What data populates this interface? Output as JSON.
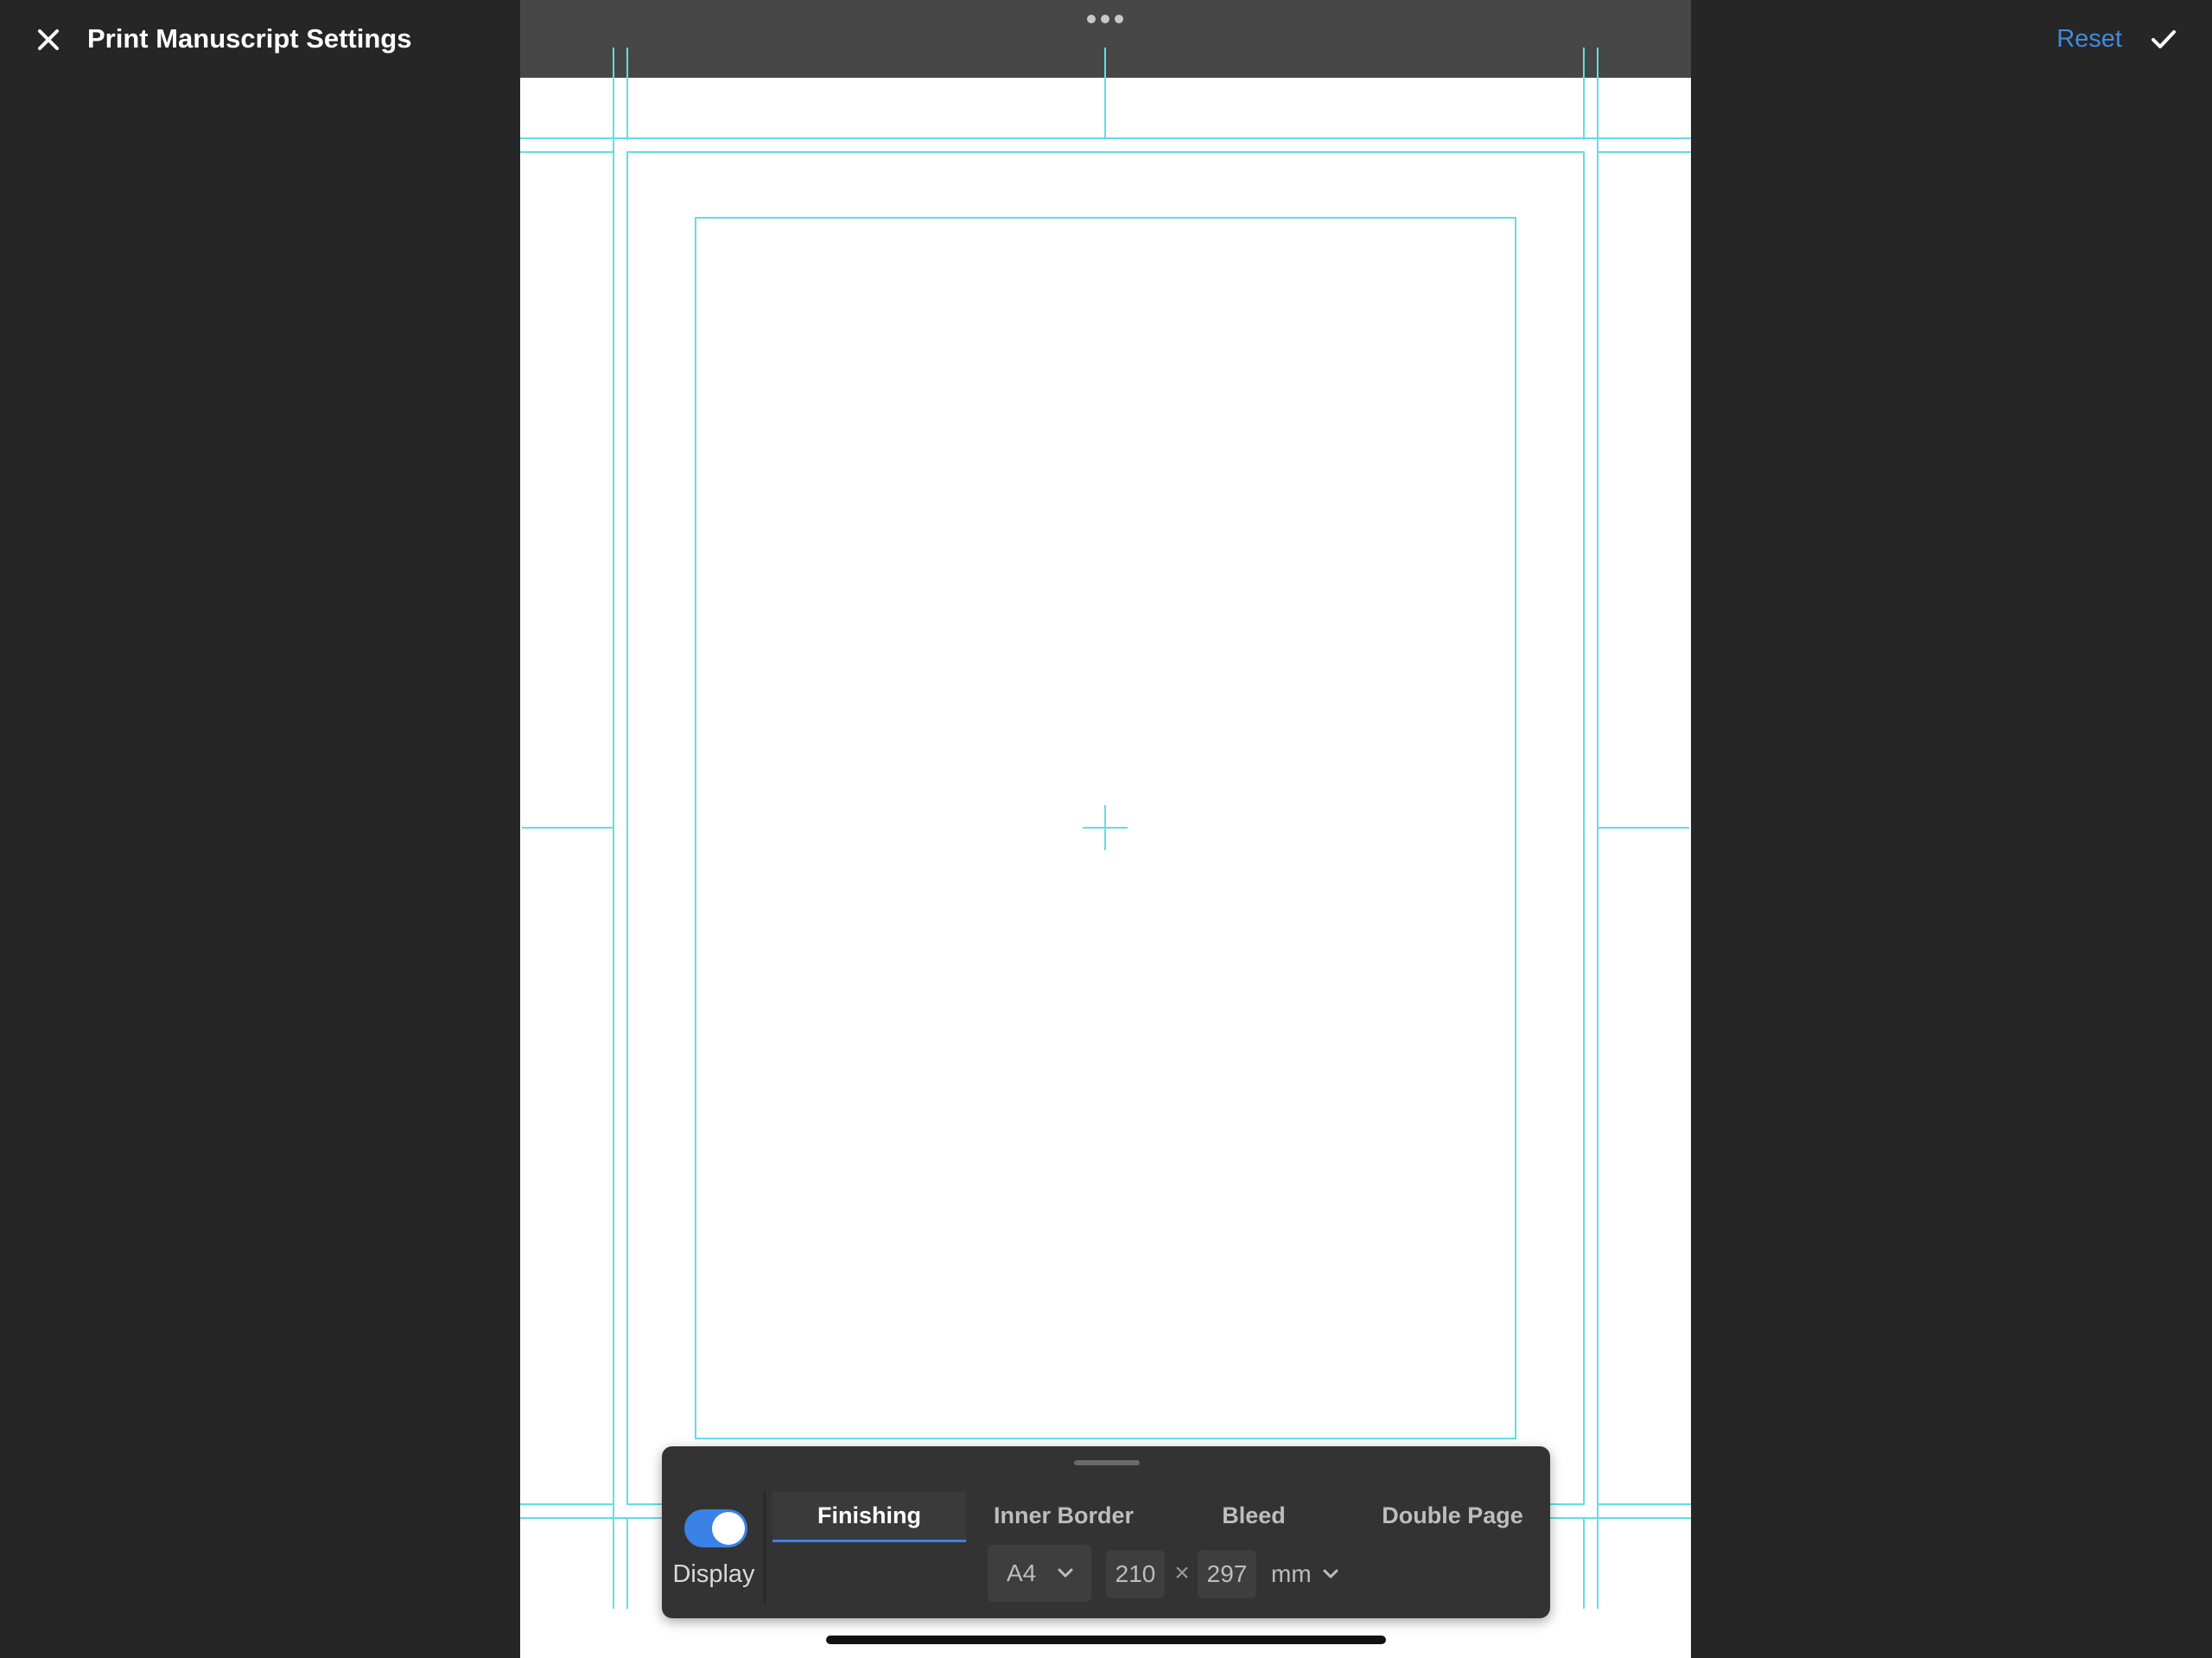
{
  "header": {
    "title": "Print Manuscript Settings",
    "close_icon": "close-icon",
    "reset_label": "Reset",
    "confirm_icon": "checkmark-icon"
  },
  "canvas": {
    "more_icon": "more-horizontal-icon",
    "guide_color": "#62dde6",
    "center_mark_icon": "crosshair-icon"
  },
  "panel": {
    "toggle": {
      "label": "Display",
      "on": true,
      "accent": "#3b82e6"
    },
    "tabs": [
      {
        "label": "Finishing",
        "active": true
      },
      {
        "label": "Inner Border",
        "active": false
      },
      {
        "label": "Bleed",
        "active": false
      },
      {
        "label": "Double Page",
        "active": false
      }
    ],
    "size_preset": "A4",
    "width": "210",
    "times_symbol": "×",
    "height": "297",
    "unit": "mm",
    "chevron_icon": "chevron-down-icon"
  },
  "colors": {
    "background": "#262626",
    "accent": "#3b82e6",
    "reset_link": "#3f8be0",
    "panel": "#333333"
  }
}
